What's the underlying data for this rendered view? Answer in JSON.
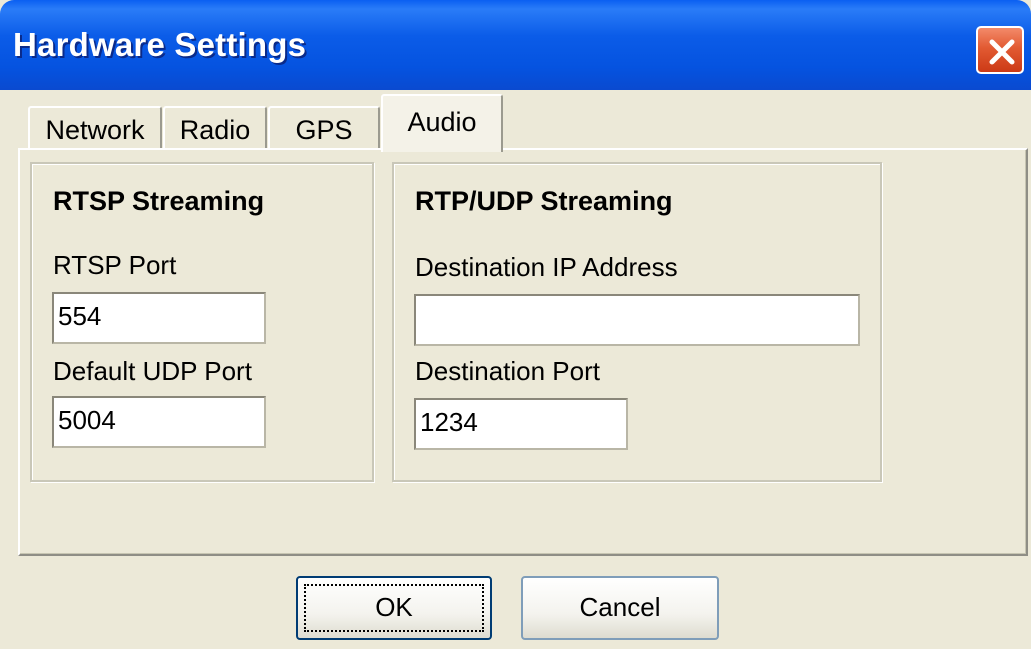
{
  "window": {
    "title": "Hardware Settings",
    "close_icon": "close-x-icon"
  },
  "tabs": [
    {
      "label": "Network",
      "active": false
    },
    {
      "label": "Radio",
      "active": false
    },
    {
      "label": "GPS",
      "active": false
    },
    {
      "label": "Audio",
      "active": true
    }
  ],
  "rtsp": {
    "title": "RTSP Streaming",
    "port_label": "RTSP Port",
    "port_value": "554",
    "udp_label": "Default UDP Port",
    "udp_value": "5004"
  },
  "rtp": {
    "title": "RTP/UDP Streaming",
    "ip_label": "Destination IP Address",
    "ip_value": "",
    "port_label": "Destination Port",
    "port_value": "1234"
  },
  "buttons": {
    "ok": "OK",
    "cancel": "Cancel"
  },
  "colors": {
    "titlebar": "#0553e0",
    "close": "#e25a32",
    "face": "#ece9d8"
  }
}
